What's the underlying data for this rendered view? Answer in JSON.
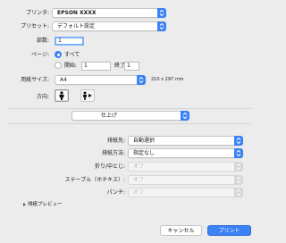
{
  "printer": {
    "label": "プリンタ:",
    "value": "EPSON XXXX"
  },
  "preset": {
    "label": "プリセット:",
    "value": "デフォルト設定"
  },
  "copies": {
    "label": "部数:",
    "value": "1"
  },
  "pages": {
    "label": "ページ:",
    "all_label": "すべて",
    "from_label": "開始:",
    "from_value": "1",
    "to_label": "終了:",
    "to_value": "1"
  },
  "paper_size": {
    "label": "用紙サイズ:",
    "value": "A4",
    "dimensions": "210 x 297 mm"
  },
  "orientation": {
    "label": "方向:"
  },
  "section_menu": {
    "value": "仕上げ"
  },
  "finishing": [
    {
      "label": "排紙先:",
      "value": "自動選択",
      "enabled": true
    },
    {
      "label": "排紙方法:",
      "value": "指定なし",
      "enabled": true
    },
    {
      "label": "折り/中とじ:",
      "value": "オフ",
      "enabled": false
    },
    {
      "label": "ステープル（ホチキス）:",
      "value": "オフ",
      "enabled": false
    },
    {
      "label": "パンチ:",
      "value": "オフ",
      "enabled": false
    }
  ],
  "preview_toggle": {
    "label": "排紙プレビュー"
  },
  "buttons": {
    "cancel": "キャンセル",
    "print": "プリント"
  },
  "colors": {
    "accent": "#3b82f6",
    "dialog_bg": "#ececec"
  }
}
